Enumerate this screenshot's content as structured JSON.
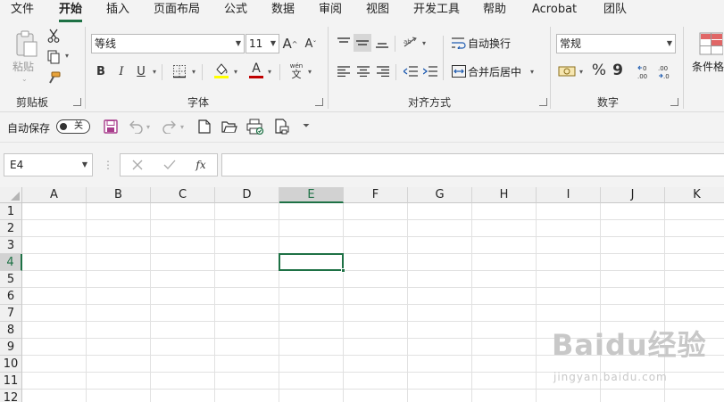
{
  "tabs": [
    "文件",
    "开始",
    "插入",
    "页面布局",
    "公式",
    "数据",
    "审阅",
    "视图",
    "开发工具",
    "帮助",
    "Acrobat",
    "团队"
  ],
  "active_tab": "开始",
  "ribbon": {
    "clipboard": {
      "paste_label": "粘贴",
      "group_label": "剪贴板"
    },
    "font": {
      "name": "等线",
      "size": "11",
      "bold": "B",
      "italic": "I",
      "underline": "U",
      "grow": "A",
      "shrink": "A",
      "font_color_letter": "A",
      "phonetic_top": "wén",
      "phonetic_bottom": "文",
      "group_label": "字体",
      "fill_color": "#ffff00",
      "font_color": "#c00000"
    },
    "alignment": {
      "wrap_text": "自动换行",
      "merge_center": "合并后居中",
      "group_label": "对齐方式"
    },
    "number": {
      "format": "常规",
      "percent": "%",
      "comma": "9",
      "group_label": "数字"
    },
    "styles": {
      "conditional_format": "条件格"
    }
  },
  "qat": {
    "autosave_label": "自动保存",
    "autosave_state": "关"
  },
  "formula_bar": {
    "name_box": "E4",
    "fx": "fx",
    "formula": ""
  },
  "grid": {
    "columns": [
      "A",
      "B",
      "C",
      "D",
      "E",
      "F",
      "G",
      "H",
      "I",
      "J",
      "K"
    ],
    "rows": [
      "1",
      "2",
      "3",
      "4",
      "5",
      "6",
      "7",
      "8",
      "9",
      "10",
      "11",
      "12"
    ],
    "active_cell": "E4",
    "active_column": "E",
    "active_row": "4"
  },
  "watermark": {
    "text": "Baidu经验",
    "sub": "jingyan.baidu.com"
  },
  "colors": {
    "accent": "#1e7145",
    "ribbon_bg": "#f3f3f3",
    "save_icon": "#a83c8c"
  }
}
